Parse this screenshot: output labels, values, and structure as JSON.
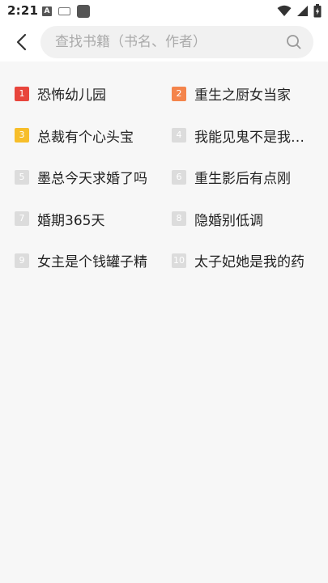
{
  "status_bar": {
    "time": "2:21",
    "notification_icons": [
      "a-icon",
      "keyboard-icon",
      "square-icon"
    ],
    "system_icons": [
      "wifi-icon",
      "signal-icon",
      "battery-icon"
    ]
  },
  "search": {
    "placeholder": "查找书籍（书名、作者）",
    "value": ""
  },
  "rank_colors": {
    "first": "#e8453c",
    "second": "#f4844b",
    "third": "#f7be2a",
    "other": "#dcdcdc"
  },
  "hot_books": [
    {
      "rank": "1",
      "title": "恐怖幼儿园"
    },
    {
      "rank": "2",
      "title": "重生之厨女当家"
    },
    {
      "rank": "3",
      "title": "总裁有个心头宝"
    },
    {
      "rank": "4",
      "title": "我能见鬼不是我的错"
    },
    {
      "rank": "5",
      "title": "墨总今天求婚了吗"
    },
    {
      "rank": "6",
      "title": "重生影后有点刚"
    },
    {
      "rank": "7",
      "title": "婚期365天"
    },
    {
      "rank": "8",
      "title": "隐婚别低调"
    },
    {
      "rank": "9",
      "title": "女主是个钱罐子精"
    },
    {
      "rank": "10",
      "title": "太子妃她是我的药"
    }
  ]
}
